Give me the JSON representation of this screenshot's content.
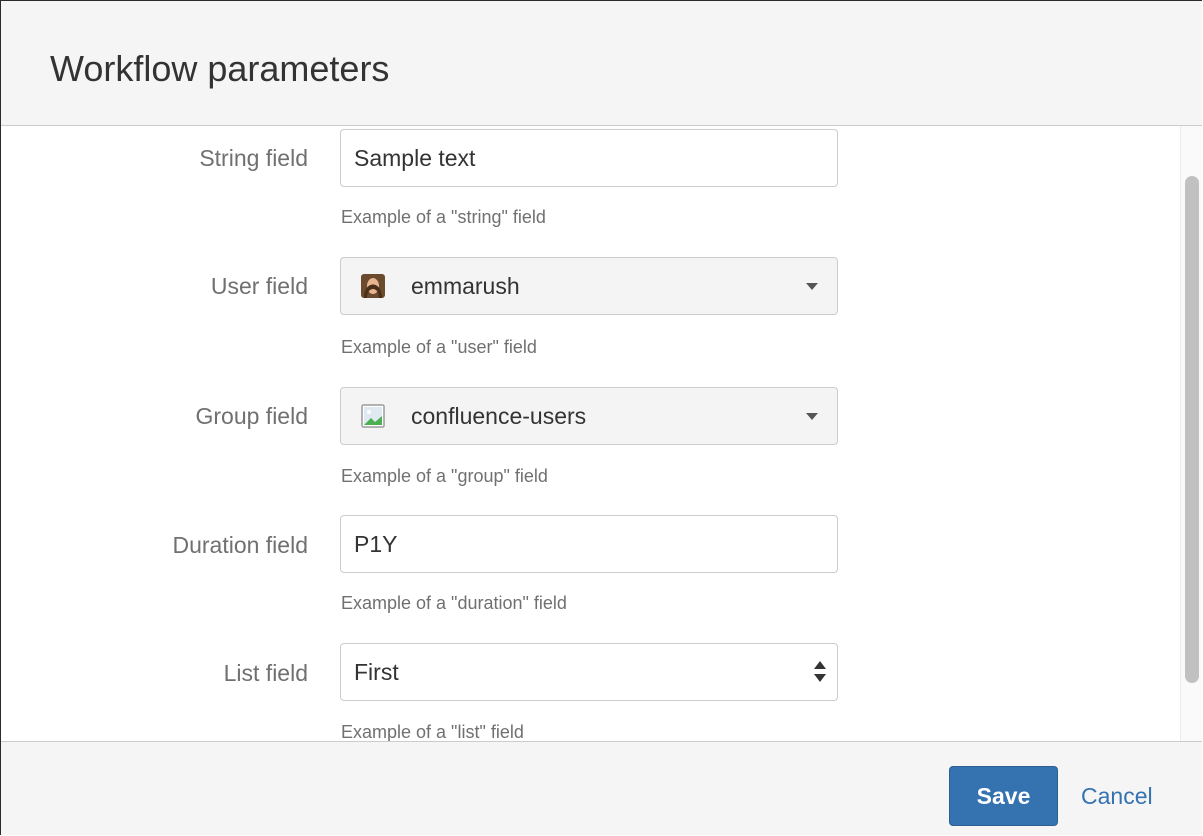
{
  "dialog": {
    "title": "Workflow parameters"
  },
  "fields": {
    "string": {
      "label": "String field",
      "value": "Sample text",
      "help": "Example of a \"string\" field"
    },
    "user": {
      "label": "User field",
      "value": "emmarush",
      "help": "Example of a \"user\" field",
      "icon": "user-avatar-icon"
    },
    "group": {
      "label": "Group field",
      "value": "confluence-users",
      "help": "Example of a \"group\" field",
      "icon": "group-image-icon"
    },
    "duration": {
      "label": "Duration field",
      "value": "P1Y",
      "help": "Example of a \"duration\" field"
    },
    "list": {
      "label": "List field",
      "value": "First",
      "help": "Example of a \"list\" field"
    }
  },
  "footer": {
    "save_label": "Save",
    "cancel_label": "Cancel"
  },
  "colors": {
    "primary": "#3572b0",
    "header_bg": "#f5f5f5",
    "label": "#707070"
  }
}
